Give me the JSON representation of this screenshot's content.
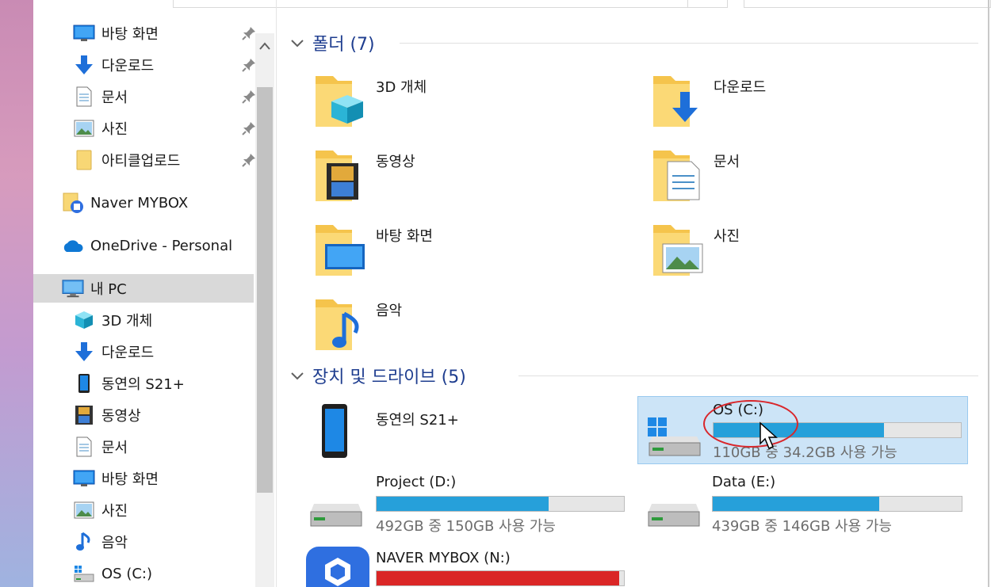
{
  "nav": {
    "quick_access": [
      {
        "label": "바탕 화면",
        "icon": "desktop-icon",
        "pinned": true
      },
      {
        "label": "다운로드",
        "icon": "download-arrow-icon",
        "pinned": true
      },
      {
        "label": "문서",
        "icon": "document-icon",
        "pinned": true
      },
      {
        "label": "사진",
        "icon": "picture-icon",
        "pinned": true
      },
      {
        "label": "아티클업로드",
        "icon": "folder-icon",
        "pinned": true
      }
    ],
    "naver_mybox": {
      "label": "Naver MYBOX",
      "icon": "naver-mybox-folder-icon"
    },
    "onedrive": {
      "label": "OneDrive - Personal",
      "icon": "cloud-icon"
    },
    "this_pc": {
      "label": "내 PC",
      "icon": "computer-icon",
      "selected": true
    },
    "pc_items": [
      {
        "label": "3D 개체",
        "icon": "cube-3d-icon"
      },
      {
        "label": "다운로드",
        "icon": "download-arrow-icon"
      },
      {
        "label": "동연의 S21+",
        "icon": "phone-icon"
      },
      {
        "label": "동영상",
        "icon": "film-icon"
      },
      {
        "label": "문서",
        "icon": "document-icon"
      },
      {
        "label": "바탕 화면",
        "icon": "desktop-icon"
      },
      {
        "label": "사진",
        "icon": "picture-icon"
      },
      {
        "label": "음악",
        "icon": "music-note-icon"
      },
      {
        "label": "OS (C:)",
        "icon": "windows-drive-icon"
      }
    ]
  },
  "content": {
    "folders_group": {
      "title": "폴더 (7)"
    },
    "folders": [
      {
        "label": "3D 개체",
        "icon": "cube-3d-folder-icon"
      },
      {
        "label": "다운로드",
        "icon": "download-folder-icon"
      },
      {
        "label": "동영상",
        "icon": "video-folder-icon"
      },
      {
        "label": "문서",
        "icon": "documents-folder-icon"
      },
      {
        "label": "바탕 화면",
        "icon": "desktop-folder-icon"
      },
      {
        "label": "사진",
        "icon": "pictures-folder-icon"
      },
      {
        "label": "음악",
        "icon": "music-folder-icon"
      }
    ],
    "devices_group": {
      "title": "장치 및 드라이브 (5)"
    },
    "devices": [
      {
        "label": "동연의 S21+",
        "icon": "phone-device-icon"
      },
      {
        "label": "OS (C:)",
        "icon": "windows-hard-drive-icon",
        "usage_text": "110GB 중 34.2GB 사용 가능",
        "used_fraction": 0.69,
        "selected": true
      },
      {
        "label": "Project (D:)",
        "icon": "hard-drive-icon",
        "usage_text": "492GB 중 150GB 사용 가능",
        "used_fraction": 0.695
      },
      {
        "label": "Data (E:)",
        "icon": "hard-drive-icon",
        "usage_text": "439GB 중 146GB 사용 가능",
        "used_fraction": 0.668
      },
      {
        "label": "NAVER MYBOX (N:)",
        "icon": "naver-mybox-app-icon",
        "used_fraction": 0.98,
        "bar_color": "#da2626"
      }
    ]
  },
  "colors": {
    "group_header": "#1e3d8f",
    "usage_fill": "#26a0da",
    "selection_bg": "#cce4f7",
    "annotation": "#d9262b"
  }
}
